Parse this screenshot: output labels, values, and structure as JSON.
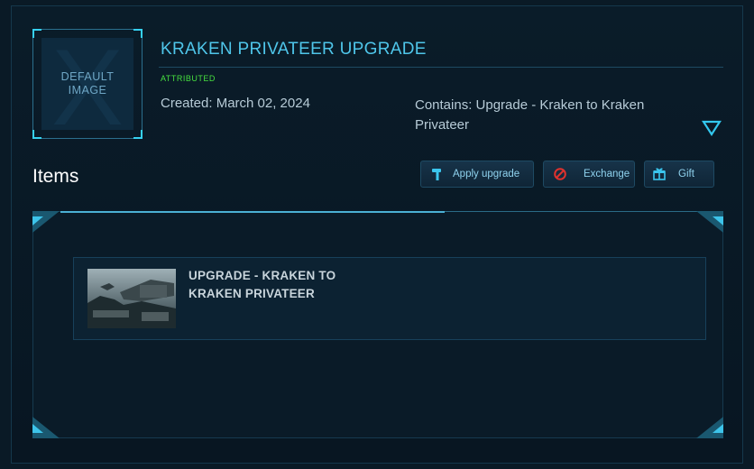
{
  "thumbnail": {
    "placeholder_text": "DEFAULT\nIMAGE",
    "watermark": "X"
  },
  "header": {
    "title": "KRAKEN PRIVATEER UPGRADE",
    "attribution": "ATTRIBUTED",
    "created": "Created: March 02, 2024",
    "contains": "Contains: Upgrade - Kraken to Kraken Privateer"
  },
  "items_section": {
    "heading": "Items"
  },
  "actions": {
    "apply_label": "Apply upgrade",
    "exchange_label": "Exchange",
    "gift_label": "Gift",
    "apply_icon": "hammer-icon",
    "exchange_icon": "prohibited-icon",
    "gift_icon": "gift-box-icon"
  },
  "items": [
    {
      "title": "UPGRADE - KRAKEN TO KRAKEN PRIVATEER",
      "image_icon": "ship-image"
    }
  ],
  "colors": {
    "accent": "#4fc6ea",
    "attributed": "#47e03f",
    "exchange_icon": "#e0322e",
    "panel_bg": "#0a1c29"
  }
}
